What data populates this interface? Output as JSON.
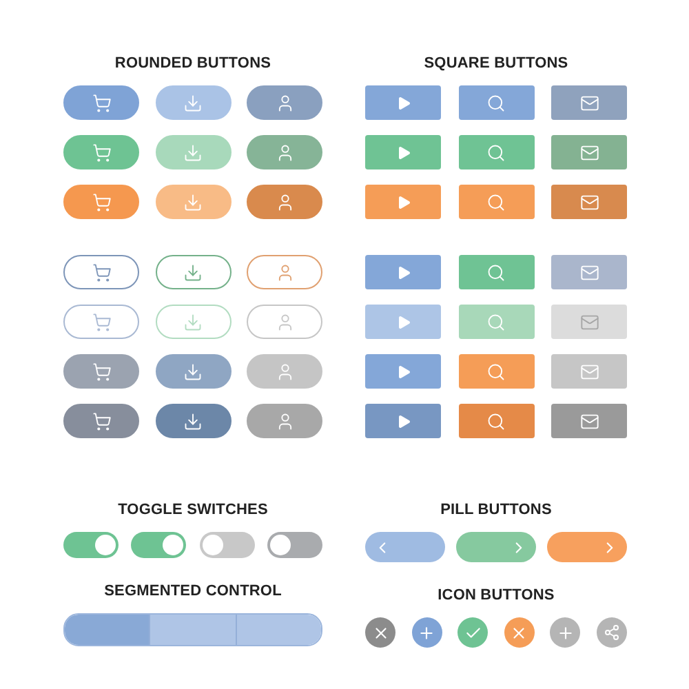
{
  "rounded_buttons": {
    "title": "ROUNDED BUTTONS",
    "groups": [
      [
        [
          {
            "kind": "cart",
            "outline": false,
            "color": "#7fa3d6"
          },
          {
            "kind": "download",
            "outline": false,
            "color": "#aac3e6"
          },
          {
            "kind": "user",
            "outline": false,
            "color": "#8aa0bf"
          }
        ],
        [
          {
            "kind": "cart",
            "outline": false,
            "color": "#6ec393"
          },
          {
            "kind": "download",
            "outline": false,
            "color": "#a8d9bb"
          },
          {
            "kind": "user",
            "outline": false,
            "color": "#86b497"
          }
        ],
        [
          {
            "kind": "cart",
            "outline": false,
            "color": "#f5984f"
          },
          {
            "kind": "download",
            "outline": false,
            "color": "#f8bb86"
          },
          {
            "kind": "user",
            "outline": false,
            "color": "#d98a4d"
          }
        ]
      ],
      [
        [
          {
            "kind": "cart",
            "outline": true,
            "color": "#7d95b8"
          },
          {
            "kind": "download",
            "outline": true,
            "color": "#74b18a"
          },
          {
            "kind": "user",
            "outline": true,
            "color": "#e0a070"
          }
        ],
        [
          {
            "kind": "cart",
            "outline": true,
            "color": "#a9b9d3"
          },
          {
            "kind": "download",
            "outline": true,
            "color": "#b2dcc1"
          },
          {
            "kind": "user",
            "outline": true,
            "color": "#c6c6c6"
          }
        ],
        [
          {
            "kind": "cart",
            "outline": false,
            "color": "#9ba3b0"
          },
          {
            "kind": "download",
            "outline": false,
            "color": "#8fa6c3"
          },
          {
            "kind": "user",
            "outline": false,
            "color": "#c5c5c5"
          }
        ],
        [
          {
            "kind": "cart",
            "outline": false,
            "color": "#878e9c"
          },
          {
            "kind": "download",
            "outline": false,
            "color": "#6c87a8"
          },
          {
            "kind": "user",
            "outline": false,
            "color": "#a8a8a8"
          }
        ]
      ]
    ]
  },
  "square_buttons": {
    "title": "SQUARE BUTTONS",
    "groups": [
      [
        [
          {
            "kind": "play",
            "color": "#84a7d8"
          },
          {
            "kind": "search",
            "color": "#84a7d8"
          },
          {
            "kind": "mail",
            "color": "#8fa2bd"
          }
        ],
        [
          {
            "kind": "play",
            "color": "#6fc394"
          },
          {
            "kind": "search",
            "color": "#6fc394"
          },
          {
            "kind": "mail",
            "color": "#84b292"
          }
        ],
        [
          {
            "kind": "play",
            "color": "#f59d57"
          },
          {
            "kind": "search",
            "color": "#f59d57"
          },
          {
            "kind": "mail",
            "color": "#d88a4e"
          }
        ]
      ],
      [
        [
          {
            "kind": "play",
            "color": "#84a7d8"
          },
          {
            "kind": "search",
            "color": "#6fc394"
          },
          {
            "kind": "mail",
            "color": "#aab6cc"
          }
        ],
        [
          {
            "kind": "play",
            "color": "#adc5e6"
          },
          {
            "kind": "search",
            "color": "#a8d8b9"
          },
          {
            "kind": "mail",
            "color": "#dcdcdc"
          }
        ],
        [
          {
            "kind": "play",
            "color": "#84a7d8"
          },
          {
            "kind": "search",
            "color": "#f59d57"
          },
          {
            "kind": "mail",
            "color": "#c6c6c6"
          }
        ],
        [
          {
            "kind": "play",
            "color": "#7897c2"
          },
          {
            "kind": "search",
            "color": "#e58a48"
          },
          {
            "kind": "mail",
            "color": "#9a9a9a"
          }
        ]
      ]
    ]
  },
  "toggle_switches": {
    "title": "TOGGLE SWITCHES",
    "items": [
      {
        "on": true,
        "color": "#6ec393"
      },
      {
        "on": true,
        "color": "#6ec393"
      },
      {
        "on": false,
        "color": "#c8c8c8"
      },
      {
        "on": false,
        "color": "#a9abae"
      }
    ]
  },
  "pill_buttons": {
    "title": "PILL BUTTONS",
    "items": [
      {
        "kind": "back",
        "color": "#9fbbe2"
      },
      {
        "kind": "next",
        "color": "#86c99f"
      },
      {
        "kind": "next",
        "color": "#f7a05e"
      }
    ]
  },
  "segmented_control": {
    "title": "SEGMENTED CONTROL",
    "segments": [
      {
        "selected": true
      },
      {
        "selected": false
      },
      {
        "selected": false
      }
    ]
  },
  "icon_buttons": {
    "title": "ICON BUTTONS",
    "items": [
      {
        "kind": "close",
        "color": "#8c8c8c"
      },
      {
        "kind": "add",
        "color": "#7fa3d6"
      },
      {
        "kind": "check",
        "color": "#6ec393"
      },
      {
        "kind": "close",
        "color": "#f59d57"
      },
      {
        "kind": "add",
        "color": "#b5b5b5"
      },
      {
        "kind": "share",
        "color": "#b5b5b5"
      }
    ]
  }
}
